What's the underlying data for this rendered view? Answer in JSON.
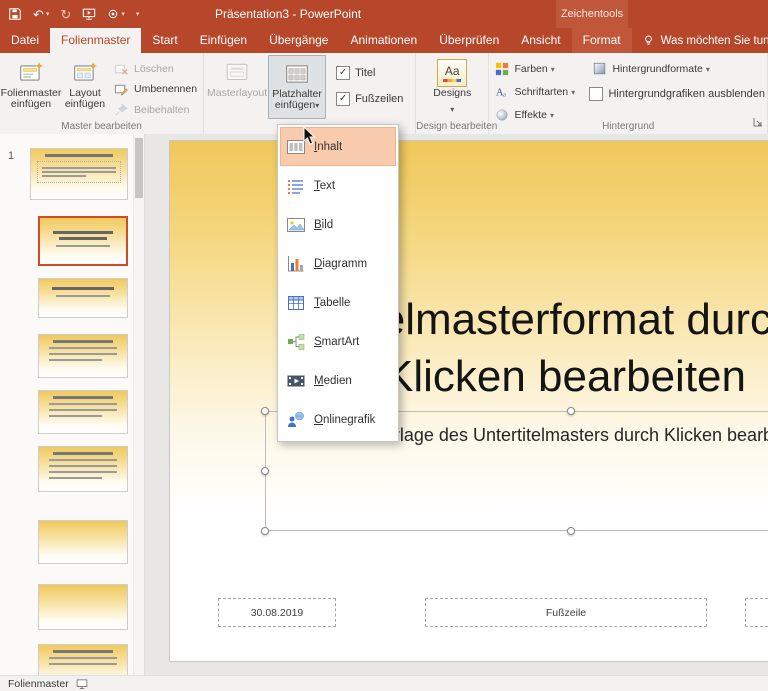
{
  "icons": {
    "undo": "↶",
    "redo": "↻",
    "qat_customize": "▾",
    "designs_glyph": "Aa"
  },
  "titlebar": {
    "title": "Präsentation3 - PowerPoint",
    "contextual_label": "Zeichentools"
  },
  "tabs": [
    {
      "label": "Datei"
    },
    {
      "label": "Folienmaster"
    },
    {
      "label": "Start"
    },
    {
      "label": "Einfügen"
    },
    {
      "label": "Übergänge"
    },
    {
      "label": "Animationen"
    },
    {
      "label": "Überprüfen"
    },
    {
      "label": "Ansicht"
    },
    {
      "label": "Format"
    }
  ],
  "search": {
    "label": "Was möchten Sie tun?"
  },
  "ribbon": {
    "master_group": {
      "label": "Master bearbeiten",
      "insert_master": "Folienmaster einfügen",
      "insert_layout": "Layout einfügen",
      "delete": "Löschen",
      "rename": "Umbenennen",
      "preserve": "Beibehalten"
    },
    "layout_group": {
      "master_layout": "Masterlayout",
      "insert_placeholder": "Platzhalter einfügen",
      "title": "Titel",
      "title_checked": "✓",
      "footers": "Fußzeilen",
      "footers_checked": "✓"
    },
    "themes_group": {
      "label": "Design bearbeiten",
      "themes": "Designs"
    },
    "background_group": {
      "label": "Hintergrund",
      "colors": "Farben",
      "fonts": "Schriftarten",
      "effects": "Effekte",
      "styles": "Hintergrundformate",
      "hide_graphics": "Hintergrundgrafiken ausblenden",
      "hide_graphics_checked": ""
    }
  },
  "placeholder_menu": {
    "items": [
      {
        "label": "Inhalt"
      },
      {
        "label": "Text"
      },
      {
        "label": "Bild"
      },
      {
        "label": "Diagramm"
      },
      {
        "label": "Tabelle"
      },
      {
        "label": "SmartArt"
      },
      {
        "label": "Medien"
      },
      {
        "label": "Onlinegrafik"
      }
    ]
  },
  "thumbnails": {
    "slide_number": "1"
  },
  "slide": {
    "title_line1": "Titelmasterformat durch",
    "title_line2": "Klicken bearbeiten",
    "subtitle": "Formatvorlage des Untertitelmasters durch Klicken bearbeiten",
    "date": "30.08.2019",
    "footer": "Fußzeile"
  },
  "statusbar": {
    "label": "Folienmaster"
  }
}
